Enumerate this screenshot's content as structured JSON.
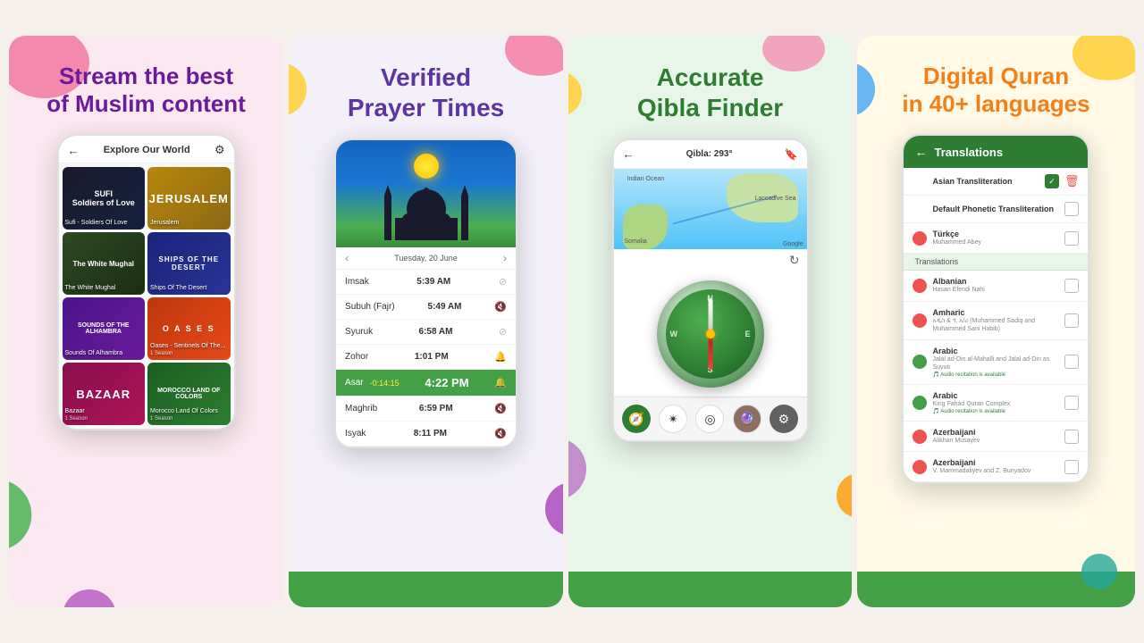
{
  "panels": {
    "stream": {
      "title_line1": "Stream the best",
      "title_line2": "of Muslim content",
      "phone": {
        "header_title": "Explore Our World",
        "videos": [
          {
            "title": "SUFI Soldiers of Love",
            "label": "Sufi - Soldiers Of Love",
            "theme": "sufi"
          },
          {
            "title": "JERUSALEM",
            "label": "Jerusalem",
            "theme": "jerusalem"
          },
          {
            "title": "The White Mughal",
            "label": "The White Mughal",
            "theme": "mughal"
          },
          {
            "title": "SHIPS OF THE DESERT",
            "label": "Ships Of The Desert",
            "theme": "ships"
          },
          {
            "title": "SOUNDS OF THE ALHAMBRA",
            "label": "Sounds Of Alhambra",
            "theme": "alhambra"
          },
          {
            "title": "O A S E S",
            "label": "Oases - Sentinels Of The...",
            "season": "1 Season",
            "theme": "oases"
          },
          {
            "title": "BAZAAR",
            "label": "Bazaar",
            "season": "1 Season",
            "theme": "bazaar"
          },
          {
            "title": "MOROCCO LAND OF COLORS",
            "label": "Morocco Land Of Colors",
            "season": "1 Season",
            "theme": "morocco"
          }
        ]
      }
    },
    "prayer": {
      "title_line1": "Verified",
      "title_line2": "Prayer Times",
      "phone": {
        "date": "Tuesday, 20 June",
        "prayers": [
          {
            "name": "Imsak",
            "time": "5:39 AM",
            "icon": "🚫",
            "active": false
          },
          {
            "name": "Subuh (Fajr)",
            "time": "5:49 AM",
            "icon": "🔇",
            "active": false
          },
          {
            "name": "Syuruk",
            "time": "6:58 AM",
            "icon": "🚫",
            "active": false
          },
          {
            "name": "Zohor",
            "time": "1:01 PM",
            "icon": "🔔",
            "active": false
          },
          {
            "name": "Asar",
            "time": "4:22 PM",
            "countdown": "-0:14:15",
            "icon": "🔔",
            "active": true
          },
          {
            "name": "Maghrib",
            "time": "6:59 PM",
            "icon": "🔇",
            "active": false
          },
          {
            "name": "Isyak",
            "time": "8:11 PM",
            "icon": "🔇",
            "active": false
          }
        ]
      }
    },
    "qibla": {
      "title_line1": "Accurate",
      "title_line2": "Qibla Finder",
      "phone": {
        "header": "Qibla: 293°",
        "compass_letters": {
          "n": "N",
          "s": "S",
          "e": "E",
          "w": "W"
        }
      }
    },
    "quran": {
      "title_line1": "Digital Quran",
      "title_line2": "in 40+ languages",
      "phone": {
        "header": "Translations",
        "translations": [
          {
            "name": "Asian Transliteration",
            "author": "",
            "checked": true,
            "has_delete": true,
            "flag": "none",
            "section": "top"
          },
          {
            "name": "Default Phonetic Transliteration",
            "author": "",
            "checked": false,
            "has_delete": false,
            "flag": "none",
            "section": "top"
          },
          {
            "name": "Türkçe",
            "author": "Muhammed Abey",
            "checked": false,
            "has_delete": false,
            "flag": "red",
            "section": "top"
          },
          {
            "name": "Albanian",
            "author": "Hasan Efendi Nahi",
            "checked": false,
            "has_delete": false,
            "flag": "red",
            "section": "translations"
          },
          {
            "name": "Amharic",
            "author": "አዲስ & ጎ, አ/ሪ (Muhammed Sadiq and Muhammed Sani Habib)",
            "checked": false,
            "has_delete": false,
            "flag": "red",
            "section": "translations"
          },
          {
            "name": "Arabic",
            "author": "Jalal ad-Din al-Mahalli and Jalal ad-Din as Suyuti",
            "audio": true,
            "checked": false,
            "has_delete": false,
            "flag": "green",
            "section": "translations"
          },
          {
            "name": "Arabic",
            "author": "King Fahad Quran Complex",
            "audio": true,
            "checked": false,
            "has_delete": false,
            "flag": "green",
            "section": "translations"
          },
          {
            "name": "Azerbaijani",
            "author": "Alikhan Musayev",
            "checked": false,
            "has_delete": false,
            "flag": "red",
            "section": "translations"
          },
          {
            "name": "Azerbaijani",
            "author": "V. Mammadaliyev and Z. Bunyadov",
            "checked": false,
            "has_delete": false,
            "flag": "red",
            "section": "translations"
          }
        ],
        "section_label": "Translations"
      }
    }
  }
}
